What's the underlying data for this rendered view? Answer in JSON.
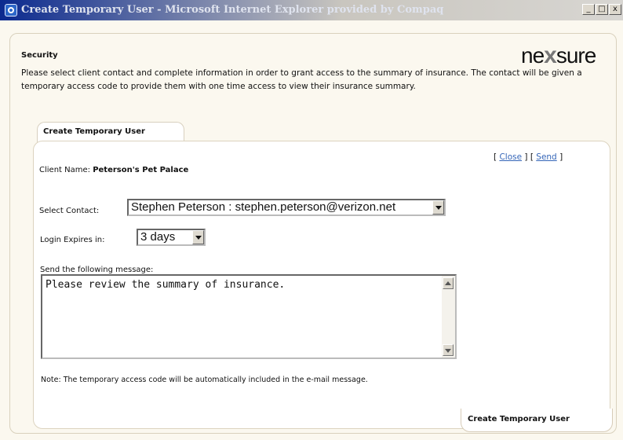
{
  "window": {
    "title": "Create Temporary User - Microsoft Internet Explorer provided by Compaq",
    "controls": [
      "_",
      "□",
      "x"
    ]
  },
  "header": {
    "section": "Security",
    "logo_left": "ne",
    "logo_x": "x",
    "logo_right": "sure",
    "intro": "Please select client contact and complete information in order to grant access to the summary of insurance. The contact will be given a temporary access code to provide them with one time access to view their insurance summary."
  },
  "tabs": [
    "Create Temporary User"
  ],
  "actions": {
    "open": "[",
    "close": "Close",
    "mid": "] [",
    "send": "Send",
    "end": "]"
  },
  "client": {
    "label": "Client Name:",
    "value": "Peterson's Pet Palace"
  },
  "contact": {
    "label": "Select Contact:",
    "value": "Stephen Peterson : stephen.peterson@verizon.net"
  },
  "expires": {
    "label": "Login Expires in:",
    "value": "3 days"
  },
  "message": {
    "label": "Send the following message:",
    "value": "Please review the summary of insurance."
  },
  "note": "Note: The temporary access code will be automatically included in the e-mail message.",
  "footer": {
    "button": "Create Temporary User"
  },
  "icons": {
    "window_icon": "internet-explorer-icon",
    "dropdown": "chevron-down-icon",
    "scroll_up": "scroll-up-icon",
    "scroll_down": "scroll-down-icon"
  }
}
